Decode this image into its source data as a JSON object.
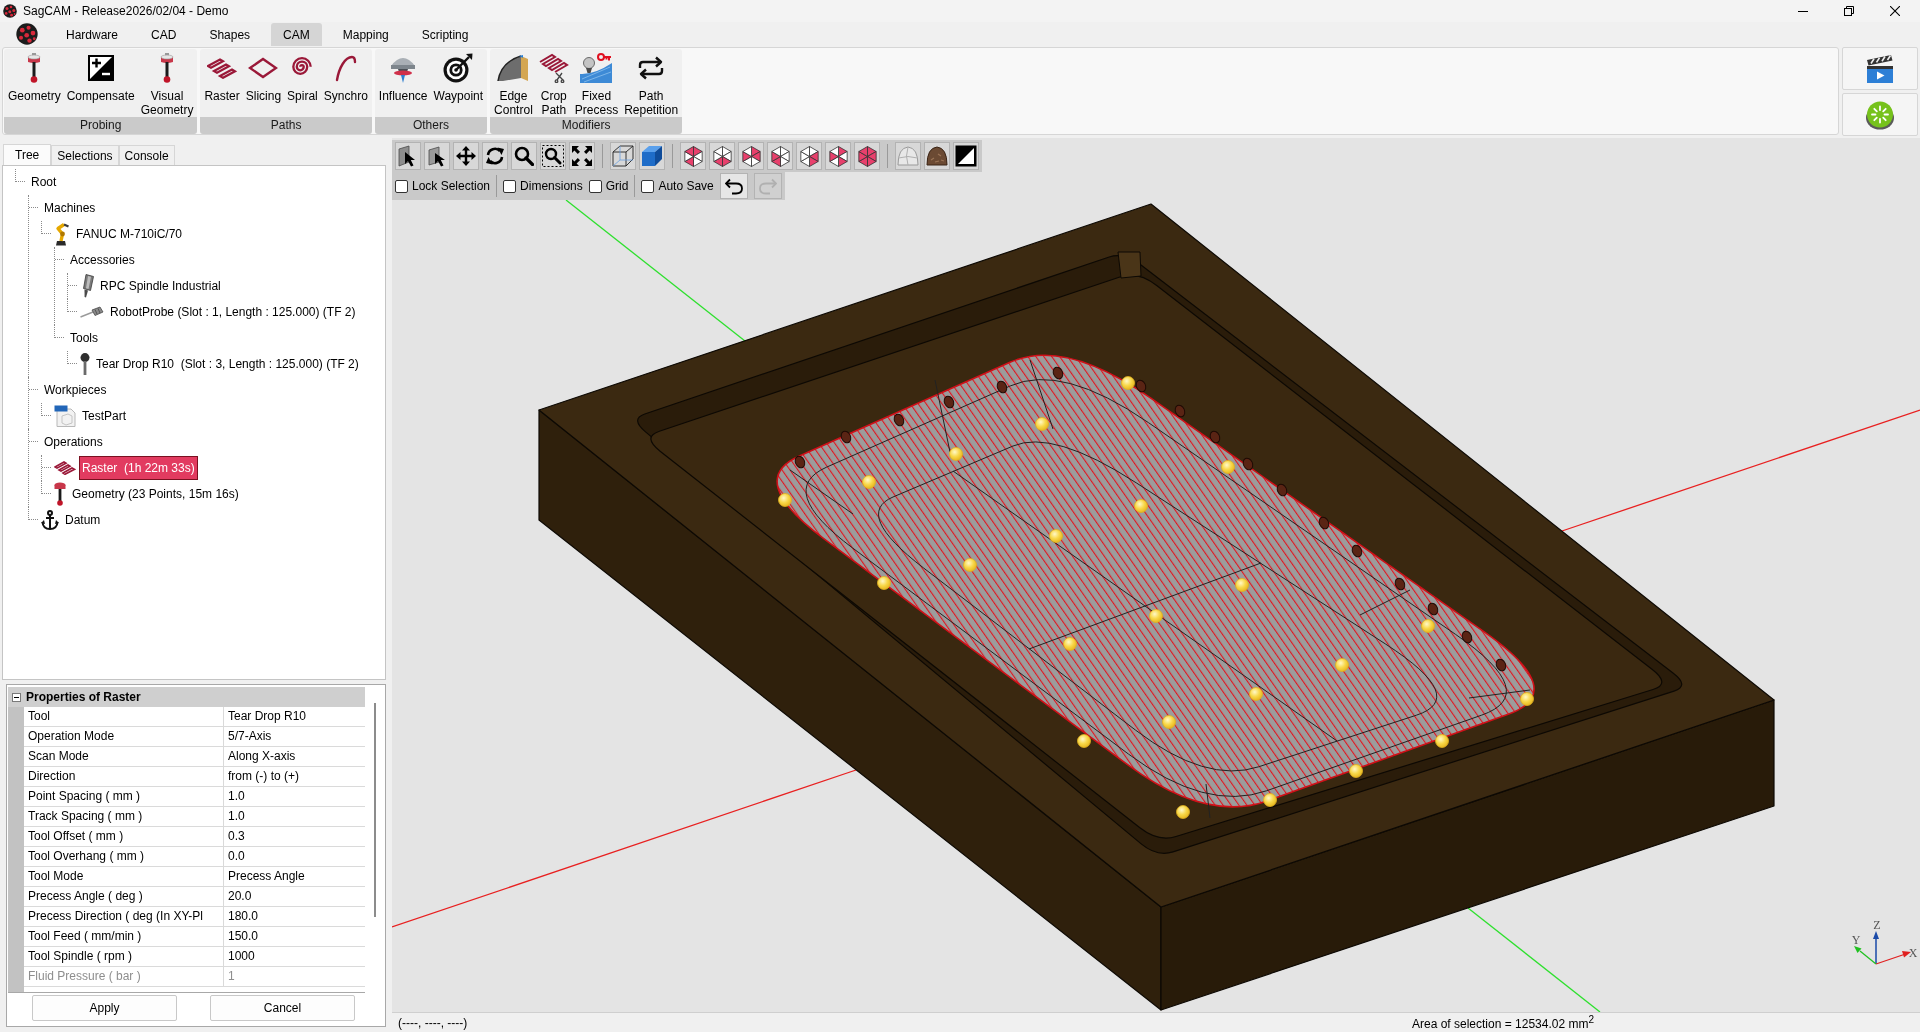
{
  "window": {
    "title": "SagCAM - Release2026/02/04 - Demo"
  },
  "menu_tabs": [
    {
      "label": "Hardware",
      "selected": false
    },
    {
      "label": "CAD",
      "selected": false
    },
    {
      "label": "Shapes",
      "selected": false
    },
    {
      "label": "CAM",
      "selected": true
    },
    {
      "label": "Mapping",
      "selected": false
    },
    {
      "label": "Scripting",
      "selected": false
    }
  ],
  "ribbon": {
    "groups": [
      {
        "label": "Probing",
        "buttons": [
          "Geometry",
          "Compensate",
          "Visual Geometry"
        ]
      },
      {
        "label": "Paths",
        "buttons": [
          "Raster",
          "Slicing",
          "Spiral",
          "Synchro"
        ]
      },
      {
        "label": "Others",
        "buttons": [
          "Influence",
          "Waypoint"
        ]
      },
      {
        "label": "Modifiers",
        "buttons": [
          "Edge Control",
          "Crop Path",
          "Fixed Precess",
          "Path Repetition"
        ]
      }
    ]
  },
  "side_panel": {
    "tabs": [
      {
        "label": "Tree",
        "selected": true
      },
      {
        "label": "Selections",
        "selected": false
      },
      {
        "label": "Console",
        "selected": false
      }
    ],
    "tree": [
      {
        "label": "Root",
        "selected": false,
        "children": [
          {
            "label": "Machines",
            "selected": false,
            "children": [
              {
                "label": "FANUC M-710iC/70",
                "kind": "robot",
                "selected": false,
                "children": [
                  {
                    "label": "Accessories",
                    "selected": false,
                    "children": [
                      {
                        "label": "RPC Spindle Industrial",
                        "kind": "spindle",
                        "selected": false
                      },
                      {
                        "label": "RobotProbe (Slot : 1, Length : 125.000) (TF 2)",
                        "kind": "probe",
                        "selected": false
                      }
                    ]
                  },
                  {
                    "label": "Tools",
                    "selected": false,
                    "children": [
                      {
                        "label": "Tear Drop R10  (Slot : 3, Length : 125.000) (TF 2)",
                        "kind": "tool",
                        "selected": false
                      }
                    ]
                  }
                ]
              }
            ]
          },
          {
            "label": "Workpieces",
            "selected": false,
            "children": [
              {
                "label": "TestPart",
                "kind": "part",
                "selected": false
              }
            ]
          },
          {
            "label": "Operations",
            "selected": false,
            "children": [
              {
                "label": "Raster  (1h 22m 33s)",
                "kind": "raster",
                "selected": true
              },
              {
                "label": "Geometry (23 Points, 15m 16s)",
                "kind": "measurement",
                "selected": false
              }
            ]
          },
          {
            "label": "Datum",
            "kind": "datum",
            "selected": false
          }
        ]
      }
    ]
  },
  "properties": {
    "title": "Properties of Raster",
    "rows": [
      {
        "label": "Tool",
        "value": "Tear Drop R10",
        "disabled": false
      },
      {
        "label": "Operation Mode",
        "value": "5/7-Axis",
        "disabled": false
      },
      {
        "label": "Scan Mode",
        "value": "Along X-axis",
        "disabled": false
      },
      {
        "label": "Direction",
        "value": "from (-) to (+)",
        "disabled": false
      },
      {
        "label": "Point Spacing ( mm )",
        "value": "1.0",
        "disabled": false
      },
      {
        "label": "Track Spacing ( mm )",
        "value": "1.0",
        "disabled": false
      },
      {
        "label": "Tool Offset ( mm )",
        "value": "0.3",
        "disabled": false
      },
      {
        "label": "Tool Overhang ( mm )",
        "value": "0.0",
        "disabled": false
      },
      {
        "label": "Tool Mode",
        "value": "Precess Angle",
        "disabled": false
      },
      {
        "label": "Precess Angle ( deg )",
        "value": "20.0",
        "disabled": false
      },
      {
        "label": "Precess Direction ( deg (In XY-Pl",
        "value": "180.0",
        "disabled": false
      },
      {
        "label": "Tool Feed ( mm/min )",
        "value": "150.0",
        "disabled": false
      },
      {
        "label": "Tool Spindle ( rpm )",
        "value": "1000",
        "disabled": false
      },
      {
        "label": "Fluid Pressure ( bar )",
        "value": "1",
        "disabled": true
      }
    ],
    "buttons": [
      "Apply",
      "Cancel"
    ]
  },
  "viewport": {
    "option_groups": [
      [
        {
          "label": "Lock Selection",
          "checked": false
        }
      ],
      [
        {
          "label": "Dimensions",
          "checked": false
        },
        {
          "label": "Grid",
          "checked": false
        }
      ],
      [
        {
          "label": "Auto Save",
          "checked": false
        }
      ]
    ],
    "history": [
      {
        "kind": "undo",
        "disabled": false
      },
      {
        "kind": "redo",
        "disabled": true
      }
    ],
    "axis_labels": {
      "x": "X",
      "y": "Y",
      "z": "Z"
    }
  },
  "status_bar": {
    "coordinates": "(----, ----, ----)",
    "selection_area": "Area of selection = 12534.02 mm$^{2}$"
  }
}
